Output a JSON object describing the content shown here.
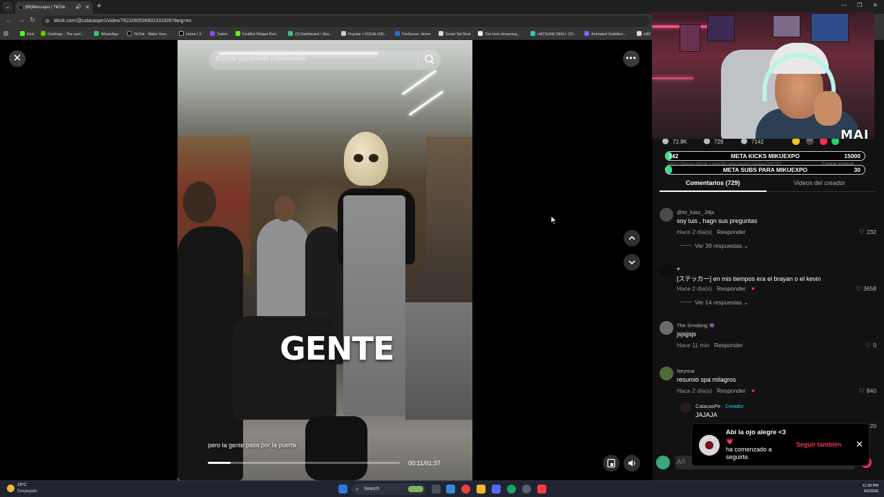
{
  "browser": {
    "tab_title": "(88)Mensajes | TikTok",
    "url": "tiktok.com/@calacaspe1/video/7623280536802331926?lang=es",
    "bookmarks": [
      "Kick",
      "Duolingo - The worl...",
      "WhatsApp",
      "TikTok - Make Your...",
      "Home / X",
      "Twitch",
      "KickBot Widget Buil...",
      "(3) Dashboard / Stre...",
      "Popular | VOCALOID...",
      "PreSonus: Home",
      "Script Tail Beat",
      "The best streaming...",
      "HATSUNE MIKU: CO...",
      "Animated Subtitles...",
      "HAT"
    ]
  },
  "player": {
    "search_placeholder": "Buscar contenido relacionado",
    "overlay_word": "GENTE",
    "caption": "pero la gente pasa por la puerta",
    "time": "00:11/01:37",
    "progress": 0.12
  },
  "stats": {
    "likes": "72.8K",
    "comments": "729",
    "saves": "7142"
  },
  "ghost": {
    "url": "https://www.tiktok.com/@calacaspe1/video/76232...",
    "copy": "Copiar enlace"
  },
  "goals": [
    {
      "current": "242",
      "label": "META KICKS MIKUEXPO",
      "target": "15000",
      "fraction": 0.016
    },
    {
      "current": "",
      "label": "META SUBS PARA MIKUEXPO",
      "target": "30",
      "fraction": 0.0
    }
  ],
  "panel_tabs": {
    "comments": "Comentarios (729)",
    "creator_videos": "Videos del creador"
  },
  "comments": [
    {
      "user": "@itz_luisz_.26​js",
      "text": "soy luis , hagn sus preguntas",
      "time": "Hace 2 día(s)",
      "reply": "Responder",
      "likes": "232",
      "replies": "Ver 39 respuestas",
      "avatar_color": "#4a4a4a"
    },
    {
      "user": "♥",
      "text": "[ステッカー] en mis tiempos era el brayan o el kevin",
      "time": "Hace 2 día(s)",
      "reply": "Responder",
      "likes": "3658",
      "replies": "Ver 14 respuestas",
      "avatar_color": "#0d0d0d"
    },
    {
      "user": "The Smoking 👾",
      "text": "jsjsjjsjs",
      "time": "Hace 11 min",
      "reply": "Responder",
      "likes": "0",
      "replies": "",
      "avatar_color": "#6b6b6b"
    },
    {
      "user": "Neymar",
      "text": "resumió spa milagros",
      "time": "Hace 2 día(s)",
      "reply": "Responder",
      "likes": "840",
      "replies": "",
      "avatar_color": "#4f6b3a"
    }
  ],
  "creator_reply": {
    "user": "CalacasPe",
    "badge": "· Creador",
    "text": "JAJAJA",
    "likes": "20"
  },
  "toast": {
    "name": "Abi la ojo alegre <3",
    "heart": "💗",
    "message": "ha comenzado a seguirte.",
    "follow": "Seguir también"
  },
  "compose": {
    "placeholder": "Añ"
  },
  "webcam": {
    "logo": "MAI"
  },
  "taskbar": {
    "temp": "19°C",
    "weather": "Despejado",
    "search": "Search",
    "time": "11:30 PM",
    "date": "4/2/2026"
  }
}
